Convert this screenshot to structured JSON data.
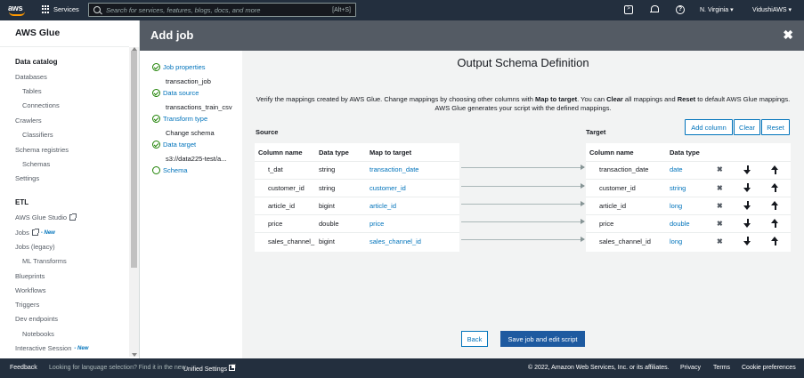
{
  "topnav": {
    "logo": "aws",
    "services": "Services",
    "search_placeholder": "Search for services, features, blogs, docs, and more",
    "search_shortcut": "[Alt+S]",
    "region": "N. Virginia ▾",
    "account": "VidushiAWS ▾"
  },
  "sidebar": {
    "title": "AWS Glue",
    "data_catalog": "Data catalog",
    "databases": "Databases",
    "tables": "Tables",
    "connections": "Connections",
    "crawlers": "Crawlers",
    "classifiers": "Classifiers",
    "schema_registries": "Schema registries",
    "schemas": "Schemas",
    "settings": "Settings",
    "etl": "ETL",
    "glue_studio": "AWS Glue Studio",
    "jobs": "Jobs",
    "new": "- New",
    "jobs_legacy": "Jobs (legacy)",
    "ml_transforms": "ML Transforms",
    "blueprints": "Blueprints",
    "workflows": "Workflows",
    "triggers": "Triggers",
    "dev_endpoints": "Dev endpoints",
    "notebooks": "Notebooks",
    "interactive_session": "Interactive Session"
  },
  "modal": {
    "title": "Add job",
    "close": "✖"
  },
  "steps": [
    {
      "label": "Job properties",
      "value": "transaction_job"
    },
    {
      "label": "Data source",
      "value": "transactions_train_csv"
    },
    {
      "label": "Transform type",
      "value": "Change schema"
    },
    {
      "label": "Data target",
      "value": "s3://data225-test/a..."
    },
    {
      "label": "Schema",
      "value": ""
    }
  ],
  "main": {
    "title": "Output Schema Definition",
    "desc_1": "Verify the mappings created by AWS Glue. Change mappings by choosing other columns with ",
    "desc_map": "Map to target",
    "desc_2": ". You can ",
    "desc_clear": "Clear",
    "desc_3": " all mappings and ",
    "desc_reset": "Reset",
    "desc_4": " to default AWS Glue mappings. AWS Glue generates your script with the defined mappings.",
    "source_label": "Source",
    "target_label": "Target",
    "add_column": "Add column",
    "clear": "Clear",
    "reset": "Reset",
    "source_headers": [
      "Column name",
      "Data type",
      "Map to target"
    ],
    "target_headers": [
      "Column name",
      "Data type"
    ],
    "rows": [
      {
        "src": "t_dat",
        "type": "string",
        "map": "transaction_date",
        "tgt": "transaction_date",
        "ttype": "date"
      },
      {
        "src": "customer_id",
        "type": "string",
        "map": "customer_id",
        "tgt": "customer_id",
        "ttype": "string"
      },
      {
        "src": "article_id",
        "type": "bigint",
        "map": "article_id",
        "tgt": "article_id",
        "ttype": "long"
      },
      {
        "src": "price",
        "type": "double",
        "map": "price",
        "tgt": "price",
        "ttype": "double"
      },
      {
        "src": "sales_channel_",
        "type": "bigint",
        "map": "sales_channel_id",
        "tgt": "sales_channel_id",
        "ttype": "long"
      }
    ],
    "back": "Back",
    "save": "Save job and edit script"
  },
  "footer": {
    "feedback": "Feedback",
    "lang": "Looking for language selection? Find it in the new",
    "unified": "Unified Settings",
    "copyright": "© 2022, Amazon Web Services, Inc. or its affiliates.",
    "privacy": "Privacy",
    "terms": "Terms",
    "cookies": "Cookie preferences"
  }
}
